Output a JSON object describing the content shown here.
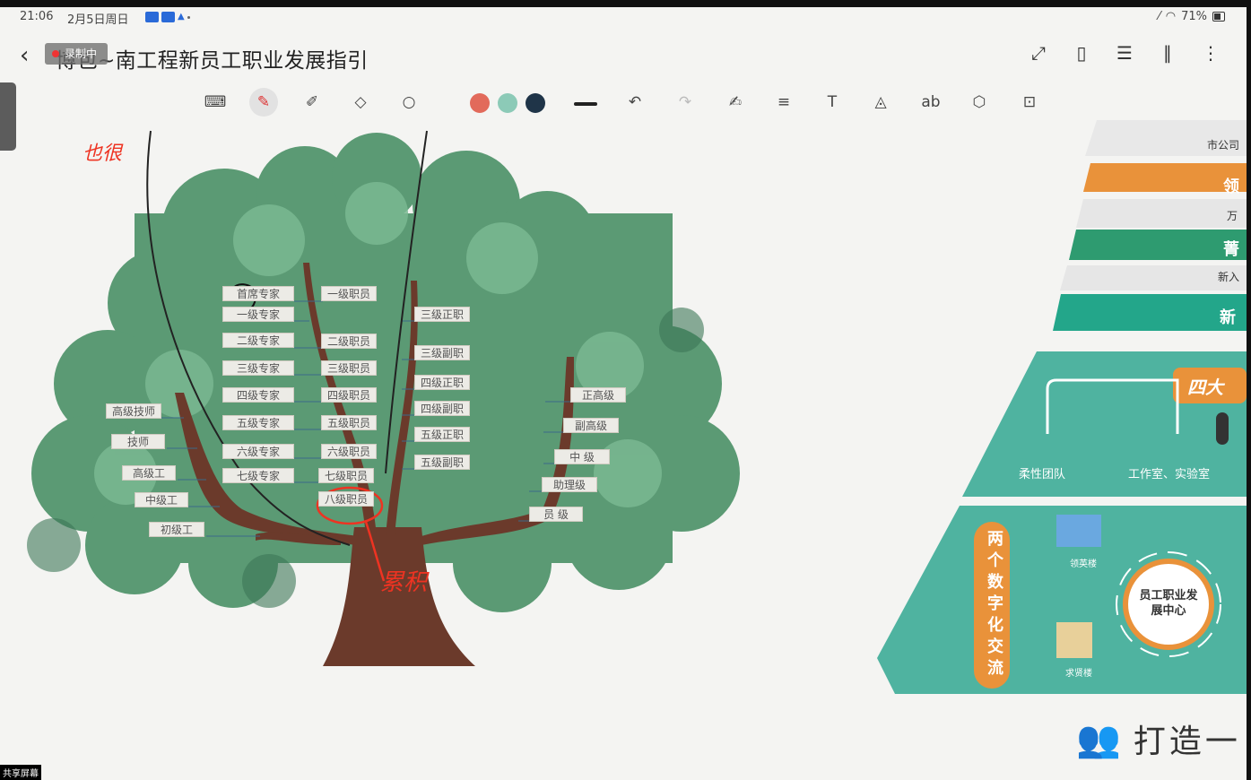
{
  "status": {
    "time": "21:06",
    "date": "2月5日周日",
    "battery": "71%"
  },
  "header": {
    "title": "博包~南工程新员工职业发展指引",
    "overlay_label": "录制中"
  },
  "toolbar": {
    "icons": [
      "keyboard-icon",
      "pen-icon",
      "highlighter-icon",
      "eraser-icon",
      "lasso-icon",
      "color-red",
      "color-teal",
      "color-navy",
      "stroke-width-icon",
      "undo-icon",
      "redo-icon",
      "ai-pen-icon",
      "text-align-icon",
      "text-tool-icon",
      "shape-recognize-icon",
      "text-box-icon",
      "shapes-icon",
      "lock-icon"
    ],
    "colors": {
      "red": "#e26a5b",
      "teal": "#8ccab7",
      "navy": "#1f3448"
    }
  },
  "annotations": {
    "top_left": "也很",
    "bottom_center": "累积"
  },
  "tree": {
    "expert_track": [
      "首席专家",
      "一级专家",
      "二级专家",
      "三级专家",
      "四级专家",
      "五级专家",
      "六级专家",
      "七级专家"
    ],
    "staff_track": [
      "一级职员",
      "二级职员",
      "三级职员",
      "四级职员",
      "五级职员",
      "六级职员",
      "七级职员",
      "八级职员"
    ],
    "mgmt_track": [
      "三级正职",
      "三级副职",
      "四级正职",
      "四级副职",
      "五级正职",
      "五级副职"
    ],
    "skill_track": [
      "高级技师",
      "技师",
      "高级工",
      "中级工",
      "初级工"
    ],
    "title_track": [
      "正高级",
      "副高级",
      "中 级",
      "助理级",
      "员 级"
    ]
  },
  "right_panel": {
    "levels": [
      {
        "small": "市公司",
        "band": "领"
      },
      {
        "small": "万",
        "band": "菁"
      },
      {
        "small": "新入",
        "band": "新"
      }
    ],
    "section_a": {
      "badge": "四大",
      "items": [
        "柔性团队",
        "工作室、实验室"
      ]
    },
    "section_b": {
      "vertical": "两个数字化交流",
      "items": [
        "领英楼",
        "求贤楼"
      ],
      "center": "员工职业发展中心"
    }
  },
  "bottom": {
    "title": "打造一"
  },
  "corner_tag": "共享屏幕"
}
